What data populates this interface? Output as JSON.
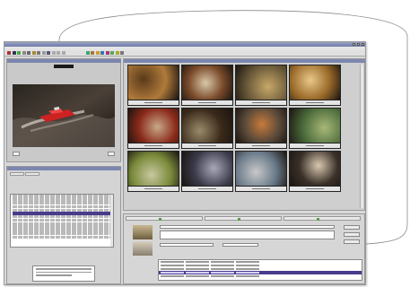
{
  "app": {
    "title": ""
  },
  "colors": {
    "titlebar": "#7c86ae",
    "selection": "#4a3b8c",
    "panel": "#d8d8d8",
    "cable": "#8a8a8a"
  },
  "icons": [
    "play-icon",
    "pause-icon",
    "stop-icon",
    "folder-icon",
    "save-icon"
  ],
  "thumbnails": [
    {
      "name": "thumb-1"
    },
    {
      "name": "thumb-2"
    },
    {
      "name": "thumb-3"
    },
    {
      "name": "thumb-4"
    },
    {
      "name": "thumb-5"
    },
    {
      "name": "thumb-6"
    },
    {
      "name": "thumb-7"
    },
    {
      "name": "thumb-8"
    },
    {
      "name": "thumb-9"
    },
    {
      "name": "thumb-10"
    },
    {
      "name": "thumb-11"
    },
    {
      "name": "thumb-12"
    }
  ]
}
